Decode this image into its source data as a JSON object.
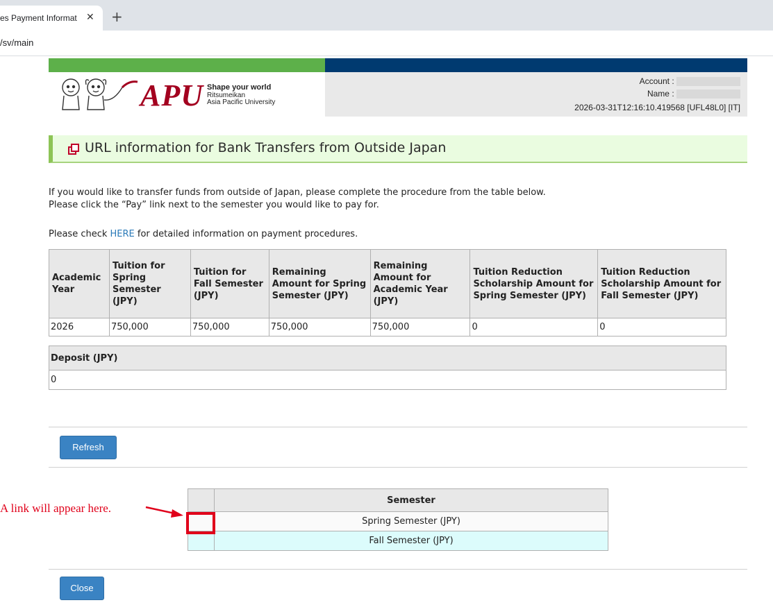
{
  "browser": {
    "tab_title": "es Payment Informat",
    "tab_close": "✕",
    "new_tab": "+",
    "url": "/sv/main"
  },
  "header": {
    "logo_text": "APU",
    "tagline": "Shape your world",
    "org_line1": "Ritsumeikan",
    "org_line2": "Asia Pacific University",
    "account_label": "Account :",
    "name_label": "Name :",
    "session_info": "2026-03-31T12:16:10.419568 [UFL48L0] [IT]"
  },
  "page": {
    "title": "URL information for Bank Transfers from Outside Japan",
    "intro_line1": "If you would like to transfer funds from outside of Japan, please complete the procedure from the table below.",
    "intro_line2": "Please click the “Pay” link next to the semester you would like to pay for.",
    "check_prefix": "Please check ",
    "check_link": "HERE",
    "check_suffix": " for detailed information on payment procedures."
  },
  "tuition_table": {
    "headers": [
      "Academic Year",
      "Tuition for Spring Semester (JPY)",
      "Tuition for Fall Semester (JPY)",
      "Remaining Amount for Spring Semester (JPY)",
      "Remaining Amount for Academic Year (JPY)",
      "Tuition Reduction Scholarship Amount for Spring Semester (JPY)",
      "Tuition Reduction Scholarship Amount for Fall Semester (JPY)"
    ],
    "row": [
      "2026",
      "750,000",
      "750,000",
      "750,000",
      "750,000",
      "0",
      "0"
    ]
  },
  "deposit_table": {
    "header": "Deposit (JPY)",
    "value": "0"
  },
  "buttons": {
    "refresh": "Refresh",
    "close": "Close"
  },
  "semester_table": {
    "header": "Semester",
    "rows": [
      "Spring Semester (JPY)",
      "Fall Semester (JPY)"
    ]
  },
  "annotation": {
    "text": "A link will appear here."
  },
  "colors": {
    "header_green": "#5db04a",
    "header_navy": "#003a70",
    "logo_red": "#a3001f",
    "button_blue": "#3a83c3",
    "annotation_red": "#e0001a"
  }
}
